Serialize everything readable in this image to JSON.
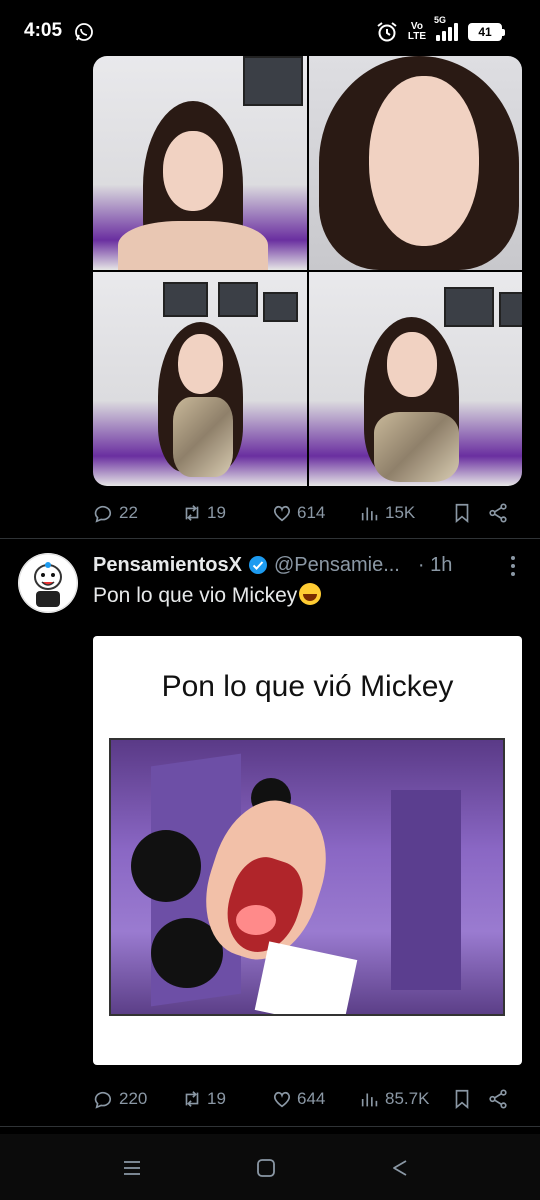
{
  "status_bar": {
    "time": "4:05",
    "network_top": "5G",
    "volte_line1": "Vo",
    "volte_line2": "LTE",
    "battery": "41"
  },
  "tweet1": {
    "actions": {
      "replies": "22",
      "reposts": "19",
      "likes": "614",
      "views": "15K"
    }
  },
  "tweet2": {
    "display_name": "PensamientosX",
    "handle": "@Pensamie...",
    "time": "· 1h",
    "text": "Pon lo que vio Mickey",
    "meme_caption": "Pon lo que vió Mickey",
    "actions": {
      "replies": "220",
      "reposts": "19",
      "likes": "644",
      "views": "85.7K"
    }
  },
  "colors": {
    "background": "#000000",
    "text": "#e7e9ea",
    "muted": "#8b98a5",
    "verified": "#1d9bf0",
    "divider": "#2f3336"
  }
}
